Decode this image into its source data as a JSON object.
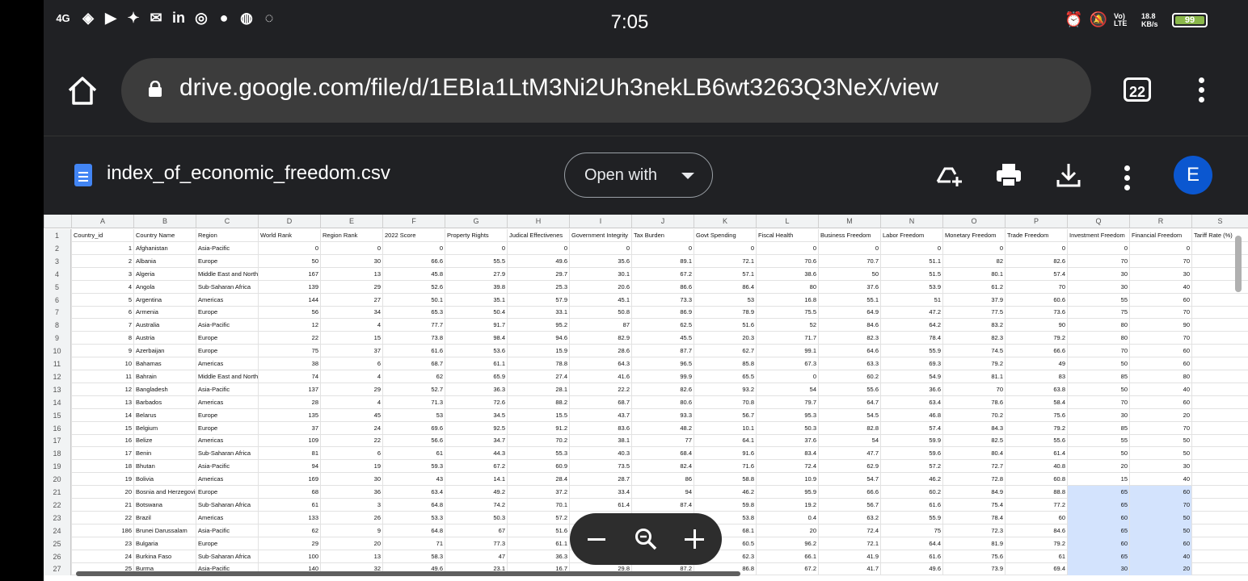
{
  "status": {
    "network": "4G",
    "time": "7:05",
    "volte": "Vo) LTE",
    "speed": "18.8 KB/s",
    "battery": "99"
  },
  "browser": {
    "url": "drive.google.com/file/d/1EBIa1LtM3Ni2Uh3nekLB6wt3263Q3NeX/view",
    "tab_count": "22"
  },
  "doc": {
    "file_name": "index_of_economic_freedom.csv",
    "open_with": "Open with",
    "avatar_letter": "E"
  },
  "sheet": {
    "col_letters": [
      "A",
      "B",
      "C",
      "D",
      "E",
      "F",
      "G",
      "H",
      "I",
      "J",
      "K",
      "L",
      "M",
      "N",
      "O",
      "P",
      "Q",
      "R",
      "S"
    ],
    "headers": [
      "Country_id",
      "Country Name",
      "Region",
      "World Rank",
      "Region Rank",
      "2022 Score",
      "Property Rights",
      "Judical Effectivenes",
      "Government Integrity",
      "Tax Burden",
      "Govt Spending",
      "Fiscal Health",
      "Business Freedom",
      "Labor Freedom",
      "Monetary Freedom",
      "Trade Freedom",
      "Investment Freedom",
      "Financial Freedom",
      "Tariff Rate (%)"
    ],
    "rows": [
      [
        "1",
        "Afghanistan",
        "Asia-Pacific",
        "0",
        "0",
        "0",
        "0",
        "0",
        "0",
        "0",
        "0",
        "0",
        "0",
        "0",
        "0",
        "0",
        "0",
        "0",
        ""
      ],
      [
        "2",
        "Albania",
        "Europe",
        "50",
        "30",
        "66.6",
        "55.5",
        "49.6",
        "35.6",
        "89.1",
        "72.1",
        "70.6",
        "70.7",
        "51.1",
        "82",
        "82.6",
        "70",
        "70",
        ""
      ],
      [
        "3",
        "Algeria",
        "Middle East and North Africa",
        "167",
        "13",
        "45.8",
        "27.9",
        "29.7",
        "30.1",
        "67.2",
        "57.1",
        "38.6",
        "50",
        "51.5",
        "80.1",
        "57.4",
        "30",
        "30",
        ""
      ],
      [
        "4",
        "Angola",
        "Sub-Saharan Africa",
        "139",
        "29",
        "52.6",
        "39.8",
        "25.3",
        "20.6",
        "86.6",
        "86.4",
        "80",
        "37.6",
        "53.9",
        "61.2",
        "70",
        "30",
        "40",
        ""
      ],
      [
        "5",
        "Argentina",
        "Americas",
        "144",
        "27",
        "50.1",
        "35.1",
        "57.9",
        "45.1",
        "73.3",
        "53",
        "16.8",
        "55.1",
        "51",
        "37.9",
        "60.6",
        "55",
        "60",
        ""
      ],
      [
        "6",
        "Armenia",
        "Europe",
        "56",
        "34",
        "65.3",
        "50.4",
        "33.1",
        "50.8",
        "86.9",
        "78.9",
        "75.5",
        "64.9",
        "47.2",
        "77.5",
        "73.6",
        "75",
        "70",
        ""
      ],
      [
        "7",
        "Australia",
        "Asia-Pacific",
        "12",
        "4",
        "77.7",
        "91.7",
        "95.2",
        "87",
        "62.5",
        "51.6",
        "52",
        "84.6",
        "64.2",
        "83.2",
        "90",
        "80",
        "90",
        ""
      ],
      [
        "8",
        "Austria",
        "Europe",
        "22",
        "15",
        "73.8",
        "98.4",
        "94.6",
        "82.9",
        "45.5",
        "20.3",
        "71.7",
        "82.3",
        "78.4",
        "82.3",
        "79.2",
        "80",
        "70",
        ""
      ],
      [
        "9",
        "Azerbaijan",
        "Europe",
        "75",
        "37",
        "61.6",
        "53.6",
        "15.9",
        "28.6",
        "87.7",
        "62.7",
        "99.1",
        "64.6",
        "55.9",
        "74.5",
        "66.6",
        "70",
        "60",
        ""
      ],
      [
        "10",
        "Bahamas",
        "Americas",
        "38",
        "6",
        "68.7",
        "61.1",
        "78.8",
        "64.3",
        "96.5",
        "85.8",
        "67.3",
        "63.3",
        "69.3",
        "79.2",
        "49",
        "50",
        "60",
        ""
      ],
      [
        "11",
        "Bahrain",
        "Middle East and North Africa",
        "74",
        "4",
        "62",
        "65.9",
        "27.4",
        "41.6",
        "99.9",
        "65.5",
        "0",
        "60.2",
        "54.9",
        "81.1",
        "83",
        "85",
        "80",
        ""
      ],
      [
        "12",
        "Bangladesh",
        "Asia-Pacific",
        "137",
        "29",
        "52.7",
        "36.3",
        "28.1",
        "22.2",
        "82.6",
        "93.2",
        "54",
        "55.6",
        "36.6",
        "70",
        "63.8",
        "50",
        "40",
        ""
      ],
      [
        "13",
        "Barbados",
        "Americas",
        "28",
        "4",
        "71.3",
        "72.6",
        "88.2",
        "68.7",
        "80.6",
        "70.8",
        "79.7",
        "64.7",
        "63.4",
        "78.6",
        "58.4",
        "70",
        "60",
        ""
      ],
      [
        "14",
        "Belarus",
        "Europe",
        "135",
        "45",
        "53",
        "34.5",
        "15.5",
        "43.7",
        "93.3",
        "56.7",
        "95.3",
        "54.5",
        "46.8",
        "70.2",
        "75.6",
        "30",
        "20",
        ""
      ],
      [
        "15",
        "Belgium",
        "Europe",
        "37",
        "24",
        "69.6",
        "92.5",
        "91.2",
        "83.6",
        "48.2",
        "10.1",
        "50.3",
        "82.8",
        "57.4",
        "84.3",
        "79.2",
        "85",
        "70",
        ""
      ],
      [
        "16",
        "Belize",
        "Americas",
        "109",
        "22",
        "56.6",
        "34.7",
        "70.2",
        "38.1",
        "77",
        "64.1",
        "37.6",
        "54",
        "59.9",
        "82.5",
        "55.6",
        "55",
        "50",
        ""
      ],
      [
        "17",
        "Benin",
        "Sub-Saharan Africa",
        "81",
        "6",
        "61",
        "44.3",
        "55.3",
        "40.3",
        "68.4",
        "91.6",
        "83.4",
        "47.7",
        "59.6",
        "80.4",
        "61.4",
        "50",
        "50",
        ""
      ],
      [
        "18",
        "Bhutan",
        "Asia-Pacific",
        "94",
        "19",
        "59.3",
        "67.2",
        "60.9",
        "73.5",
        "82.4",
        "71.6",
        "72.4",
        "62.9",
        "57.2",
        "72.7",
        "40.8",
        "20",
        "30",
        ""
      ],
      [
        "19",
        "Bolivia",
        "Americas",
        "169",
        "30",
        "43",
        "14.1",
        "28.4",
        "28.7",
        "86",
        "58.8",
        "10.9",
        "54.7",
        "46.2",
        "72.8",
        "60.8",
        "15",
        "40",
        ""
      ],
      [
        "20",
        "Bosnia and Herzegovina",
        "Europe",
        "68",
        "36",
        "63.4",
        "49.2",
        "37.2",
        "33.4",
        "94",
        "46.2",
        "95.9",
        "66.6",
        "60.2",
        "84.9",
        "88.8",
        "65",
        "60",
        ""
      ],
      [
        "21",
        "Botswana",
        "Sub-Saharan Africa",
        "61",
        "3",
        "64.8",
        "74.2",
        "70.1",
        "61.4",
        "87.4",
        "59.8",
        "19.2",
        "56.7",
        "61.6",
        "75.4",
        "77.2",
        "65",
        "70",
        ""
      ],
      [
        "22",
        "Brazil",
        "Americas",
        "133",
        "26",
        "53.3",
        "50.3",
        "57.2",
        "40",
        "69.9",
        "53.8",
        "0.4",
        "63.2",
        "55.9",
        "78.4",
        "60",
        "60",
        "50",
        ""
      ],
      [
        "186",
        "Brunei Darussalam",
        "Asia-Pacific",
        "62",
        "9",
        "64.8",
        "67",
        "51.6",
        "61.1",
        "90.8",
        "68.1",
        "20",
        "72.4",
        "75",
        "72.3",
        "84.6",
        "65",
        "50",
        ""
      ],
      [
        "23",
        "Bulgaria",
        "Europe",
        "29",
        "20",
        "71",
        "77.3",
        "61.1",
        "45.8",
        "93.9",
        "60.5",
        "96.2",
        "72.1",
        "64.4",
        "81.9",
        "79.2",
        "60",
        "60",
        ""
      ],
      [
        "24",
        "Burkina Faso",
        "Sub-Saharan Africa",
        "100",
        "13",
        "58.3",
        "47",
        "36.3",
        "41.4",
        "81.8",
        "62.3",
        "66.1",
        "41.9",
        "61.6",
        "75.6",
        "61",
        "65",
        "40",
        ""
      ],
      [
        "25",
        "Burma",
        "Asia-Pacific",
        "140",
        "32",
        "49.6",
        "23.1",
        "16.7",
        "29.8",
        "87.2",
        "86.8",
        "67.2",
        "41.7",
        "49.6",
        "73.9",
        "69.4",
        "30",
        "20",
        ""
      ]
    ]
  }
}
